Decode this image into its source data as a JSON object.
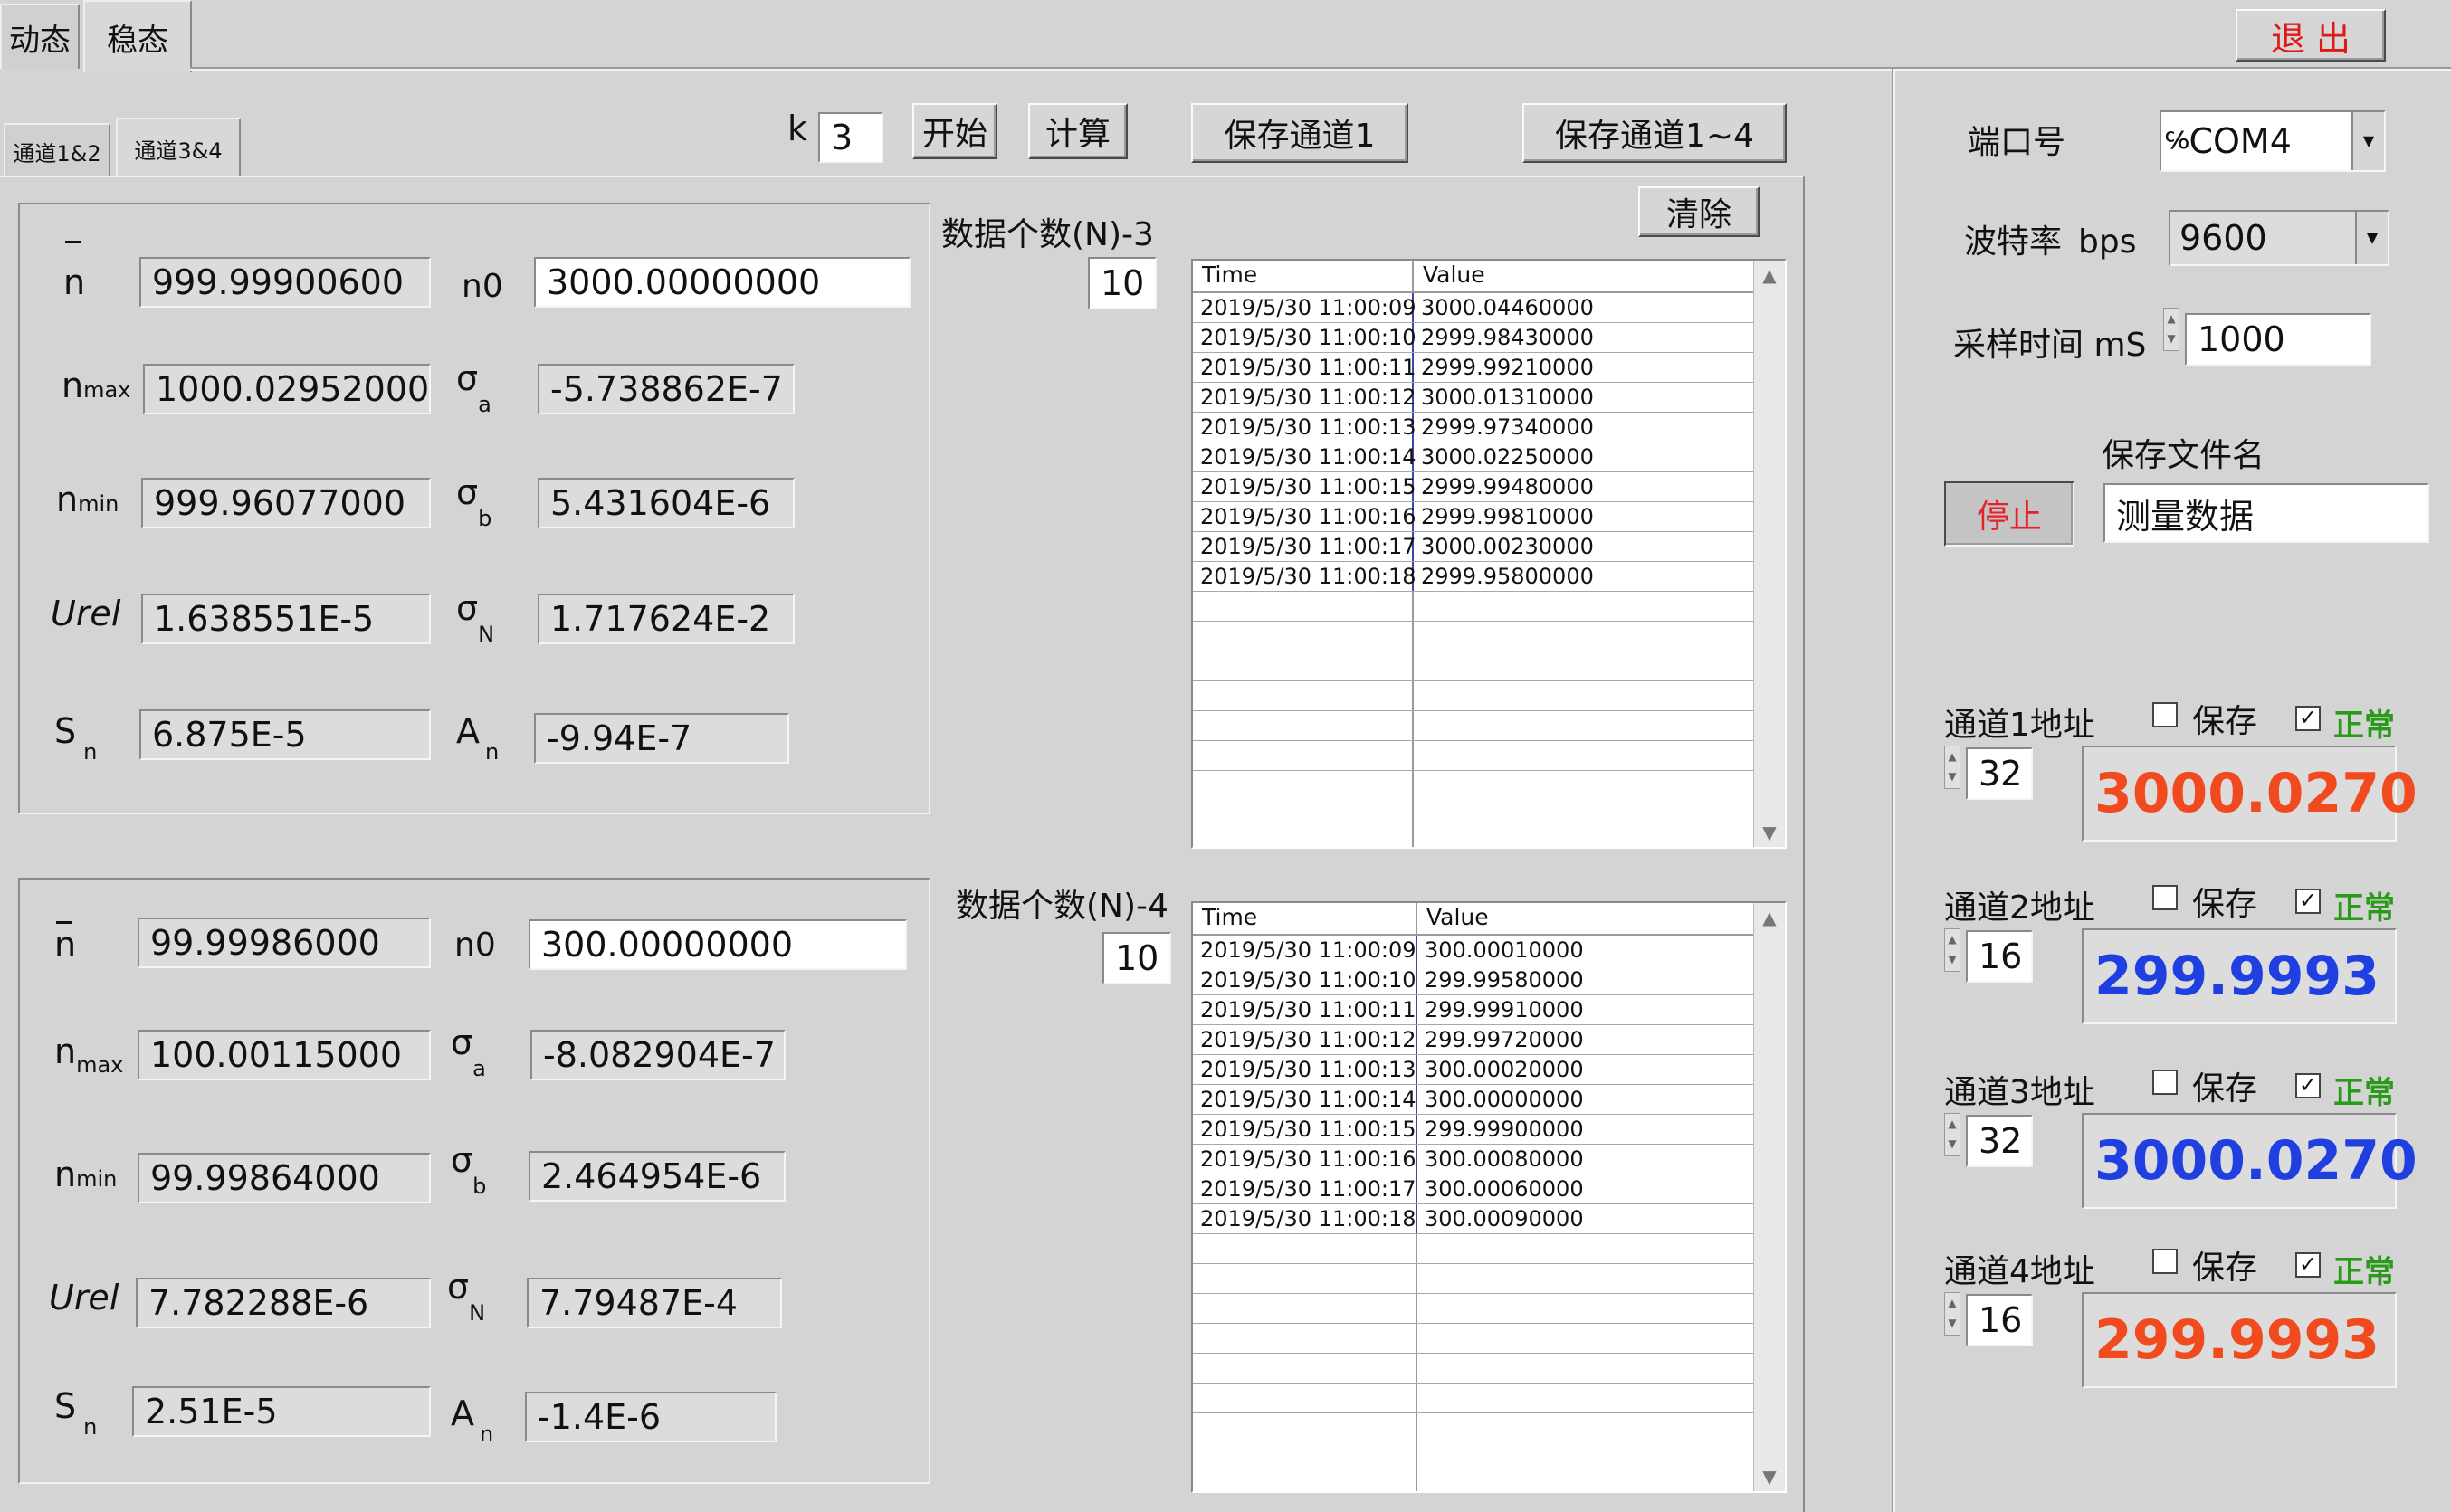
{
  "top_tabs": [
    "动态",
    "稳态"
  ],
  "exit_label": "退 出",
  "channel_tabs": [
    "通道1&2",
    "通道3&4"
  ],
  "toolbar": {
    "k_label": "k",
    "k_value": "3",
    "start_label": "开始",
    "calc_label": "计算",
    "save_ch1_label": "保存通道1",
    "save_all_label": "保存通道1~4",
    "clear_label": "清除"
  },
  "stats_top": {
    "n_bar_label": "n",
    "n_bar": "999.99900600",
    "n0_label": "n0",
    "n0": "3000.00000000",
    "nmax_label": "n",
    "nmax_sub": "max",
    "nmax": "1000.02952000",
    "sigma_a_label": "σ",
    "sigma_a_sub": "a",
    "sigma_a": "-5.738862E-7",
    "nmin_label": "n",
    "nmin_sub": "min",
    "nmin": "999.96077000",
    "sigma_b_label": "σ",
    "sigma_b_sub": "b",
    "sigma_b": "5.431604E-6",
    "urel_label": "Urel",
    "urel": "1.638551E-5",
    "sigma_n_label": "σ",
    "sigma_n_sub": "N",
    "sigma_n": "1.717624E-2",
    "sn_label": "S",
    "sn_sub": "n",
    "sn": "6.875E-5",
    "an_label": "A",
    "an_sub": "n",
    "an": "-9.94E-7"
  },
  "stats_bottom": {
    "n_bar_label": "n",
    "n_bar": "99.99986000",
    "n0_label": "n0",
    "n0": "300.00000000",
    "nmax_label": "n",
    "nmax_sub": "max",
    "nmax": "100.00115000",
    "sigma_a_label": "σ",
    "sigma_a_sub": "a",
    "sigma_a": "-8.082904E-7",
    "nmin_label": "n",
    "nmin_sub": "min",
    "nmin": "99.99864000",
    "sigma_b_label": "σ",
    "sigma_b_sub": "b",
    "sigma_b": "2.464954E-6",
    "urel_label": "Urel",
    "urel": "7.782288E-6",
    "sigma_n_label": "σ",
    "sigma_n_sub": "N",
    "sigma_n": "7.79487E-4",
    "sn_label": "S",
    "sn_sub": "n",
    "sn": "2.51E-5",
    "an_label": "A",
    "an_sub": "n",
    "an": "-1.4E-6"
  },
  "table_top": {
    "count_label": "数据个数(N)-3",
    "count": "10",
    "headers": [
      "Time",
      "Value"
    ],
    "rows": [
      [
        "2019/5/30 11:00:09",
        "3000.04460000"
      ],
      [
        "2019/5/30 11:00:10",
        "2999.98430000"
      ],
      [
        "2019/5/30 11:00:11",
        "2999.99210000"
      ],
      [
        "2019/5/30 11:00:12",
        "3000.01310000"
      ],
      [
        "2019/5/30 11:00:13",
        "2999.97340000"
      ],
      [
        "2019/5/30 11:00:14",
        "3000.02250000"
      ],
      [
        "2019/5/30 11:00:15",
        "2999.99480000"
      ],
      [
        "2019/5/30 11:00:16",
        "2999.99810000"
      ],
      [
        "2019/5/30 11:00:17",
        "3000.00230000"
      ],
      [
        "2019/5/30 11:00:18",
        "2999.95800000"
      ]
    ]
  },
  "table_bottom": {
    "count_label": "数据个数(N)-4",
    "count": "10",
    "headers": [
      "Time",
      "Value"
    ],
    "rows": [
      [
        "2019/5/30 11:00:09",
        "300.00010000"
      ],
      [
        "2019/5/30 11:00:10",
        "299.99580000"
      ],
      [
        "2019/5/30 11:00:11",
        "299.99910000"
      ],
      [
        "2019/5/30 11:00:12",
        "299.99720000"
      ],
      [
        "2019/5/30 11:00:13",
        "300.00020000"
      ],
      [
        "2019/5/30 11:00:14",
        "300.00000000"
      ],
      [
        "2019/5/30 11:00:15",
        "299.99900000"
      ],
      [
        "2019/5/30 11:00:16",
        "300.00080000"
      ],
      [
        "2019/5/30 11:00:17",
        "300.00060000"
      ],
      [
        "2019/5/30 11:00:18",
        "300.00090000"
      ]
    ]
  },
  "settings": {
    "port_label": "端口号",
    "port_prefix": "℅",
    "port_value": "COM4",
    "baud_label": "波特率",
    "baud_unit": "bps",
    "baud_value": "9600",
    "sample_label": "采样时间 mS",
    "sample_value": "1000",
    "filename_label": "保存文件名",
    "filename_value": "测量数据",
    "stop_label": "停止"
  },
  "channels": [
    {
      "label": "通道1地址",
      "address": "32",
      "save_label": "保存",
      "ok_label": "正常",
      "value": "3000.0270",
      "color": "#f04a1e"
    },
    {
      "label": "通道2地址",
      "address": "16",
      "save_label": "保存",
      "ok_label": "正常",
      "value": "299.9993",
      "color": "#1f3fe0"
    },
    {
      "label": "通道3地址",
      "address": "32",
      "save_label": "保存",
      "ok_label": "正常",
      "value": "3000.0270",
      "color": "#1f3fe0"
    },
    {
      "label": "通道4地址",
      "address": "16",
      "save_label": "保存",
      "ok_label": "正常",
      "value": "299.9993",
      "color": "#f04a1e"
    }
  ],
  "colors": {
    "ok_green": "#2a9a1a",
    "stop_red": "#e8202a",
    "exit_red": "#e01818"
  }
}
